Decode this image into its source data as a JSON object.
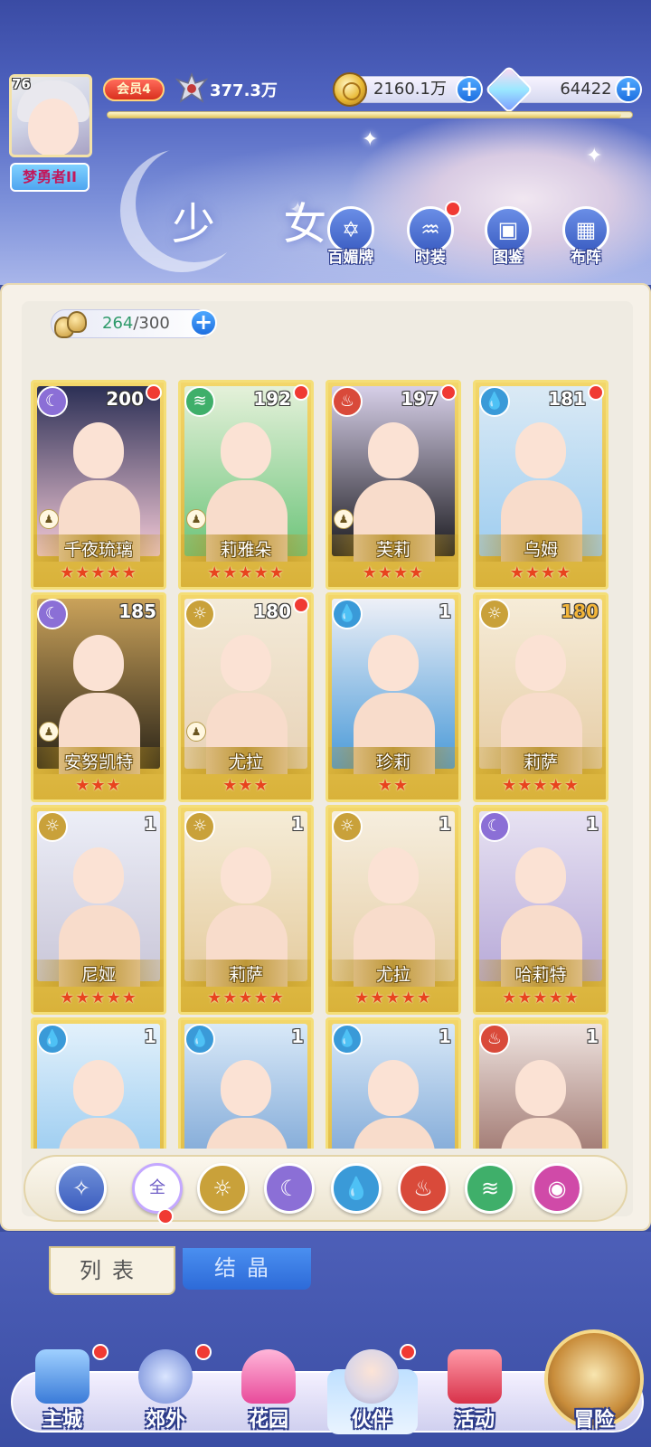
{
  "player": {
    "level": "76",
    "nickname": "梦勇者II",
    "vip": "会员4",
    "power": "377.3万",
    "exp_progress": 0.98
  },
  "resources": {
    "gold": "2160.1万",
    "gems": "64422"
  },
  "header": {
    "title": "少 女",
    "buttons": [
      {
        "label": "百媚牌",
        "badge": false
      },
      {
        "label": "时装",
        "badge": true
      },
      {
        "label": "图鉴",
        "badge": false
      },
      {
        "label": "布阵",
        "badge": false
      }
    ]
  },
  "capacity": {
    "current": "264",
    "max": "/300"
  },
  "colors": {
    "moon": "#8b6fd6",
    "light": "#c9a13a",
    "water": "#3a9ad8",
    "fire": "#d94a3a",
    "wind": "#3faf6a",
    "dark": "#d04aa8"
  },
  "cards": [
    {
      "name": "千夜琉璃",
      "level": "200",
      "element": "moon",
      "stars": "★★★★★",
      "badge": true,
      "pawn": true
    },
    {
      "name": "莉雅朵",
      "level": "192",
      "element": "wind",
      "stars": "★★★★★",
      "badge": true,
      "pawn": true
    },
    {
      "name": "芙莉",
      "level": "197",
      "element": "fire",
      "stars": "★★★★",
      "badge": true,
      "pawn": true
    },
    {
      "name": "乌姆",
      "level": "181",
      "element": "water",
      "stars": "★★★★",
      "badge": true,
      "pawn": false
    },
    {
      "name": "安努凯特",
      "level": "185",
      "element": "moon",
      "stars": "★★★",
      "badge": false,
      "pawn": true
    },
    {
      "name": "尤拉",
      "level": "180",
      "element": "light",
      "stars": "★★★",
      "badge": true,
      "pawn": true
    },
    {
      "name": "珍莉",
      "level": "1",
      "element": "water",
      "stars": "★★",
      "badge": false,
      "pawn": false
    },
    {
      "name": "莉萨",
      "level": "180",
      "element": "light",
      "stars": "★★★★★",
      "badge": false,
      "pawn": false
    },
    {
      "name": "尼娅",
      "level": "1",
      "element": "light",
      "stars": "★★★★★",
      "badge": false,
      "pawn": false
    },
    {
      "name": "莉萨",
      "level": "1",
      "element": "light",
      "stars": "★★★★★",
      "badge": false,
      "pawn": false
    },
    {
      "name": "尤拉",
      "level": "1",
      "element": "light",
      "stars": "★★★★★",
      "badge": false,
      "pawn": false
    },
    {
      "name": "哈莉特",
      "level": "1",
      "element": "moon",
      "stars": "★★★★★",
      "badge": false,
      "pawn": false
    },
    {
      "name": "",
      "level": "1",
      "element": "water",
      "stars": "",
      "badge": false,
      "pawn": false
    },
    {
      "name": "",
      "level": "1",
      "element": "water",
      "stars": "",
      "badge": false,
      "pawn": false
    },
    {
      "name": "",
      "level": "1",
      "element": "water",
      "stars": "",
      "badge": false,
      "pawn": false
    },
    {
      "name": "",
      "level": "1",
      "element": "fire",
      "stars": "",
      "badge": false,
      "pawn": false
    }
  ],
  "filters": {
    "all_label": "全",
    "items": [
      "star",
      "all",
      "light",
      "moon",
      "water",
      "fire",
      "wind",
      "dark"
    ]
  },
  "tabs": {
    "list": "列表",
    "crystal": "结晶"
  },
  "nav": [
    {
      "label": "主城",
      "badge": true
    },
    {
      "label": "郊外",
      "badge": true
    },
    {
      "label": "花园",
      "badge": false
    },
    {
      "label": "伙伴",
      "badge": true
    },
    {
      "label": "活动",
      "badge": false
    },
    {
      "label": "冒险",
      "badge": false
    }
  ]
}
